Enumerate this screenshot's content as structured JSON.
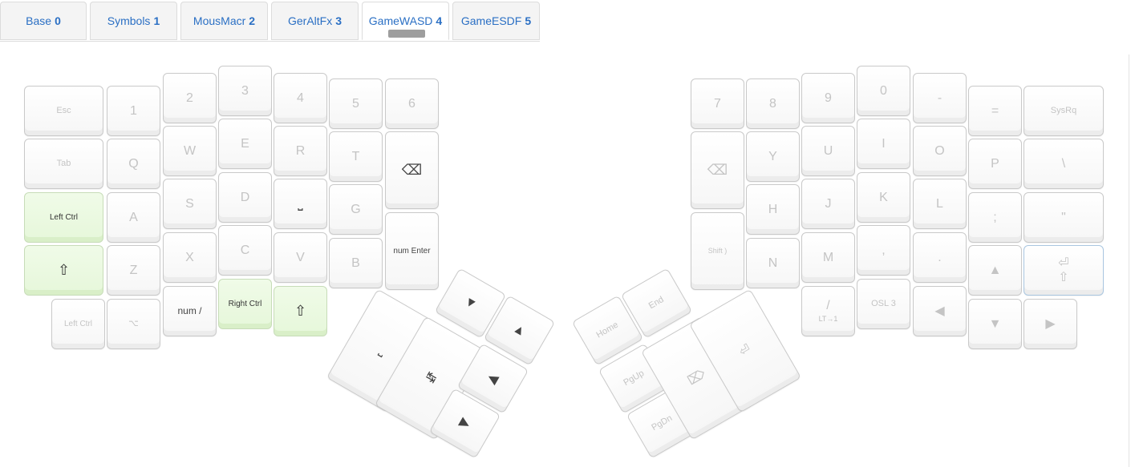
{
  "tabs": [
    {
      "label": "Base",
      "num": "0"
    },
    {
      "label": "Symbols",
      "num": "1"
    },
    {
      "label": "MousMacr",
      "num": "2"
    },
    {
      "label": "GerAltFx",
      "num": "3"
    },
    {
      "label": "GameWASD",
      "num": "4"
    },
    {
      "label": "GameESDF",
      "num": "5"
    }
  ],
  "active_tab": "GameWASD",
  "colors": {
    "accent": "#2a6fc4",
    "highlight_green": "#e6f7da",
    "selected_blue": "#a9c6e0"
  },
  "left": {
    "esc": "Esc",
    "k1": "1",
    "k2": "2",
    "k3": "3",
    "k4": "4",
    "k5": "5",
    "k6": "6",
    "tab": "Tab",
    "q": "Q",
    "w": "W",
    "e": "E",
    "r": "R",
    "t": "T",
    "bksp": "⌫",
    "lctrl": "Left Ctrl",
    "a": "A",
    "s": "S",
    "d": "D",
    "space": "⎵",
    "g": "G",
    "numenter": "num Enter",
    "shift": "⇧",
    "z": "Z",
    "x": "X",
    "c": "C",
    "v": "V",
    "b": "B",
    "lctrl2": "Left Ctrl",
    "alt": "⌥",
    "numslash": "num /",
    "rctrl": "Right Ctrl",
    "shift2": "⇧"
  },
  "left_thumb": {
    "space": "⎵",
    "tab": "↹",
    "down": "▼",
    "up": "▲",
    "left": "◀",
    "right": "▶"
  },
  "right": {
    "k7": "7",
    "k8": "8",
    "k9": "9",
    "k0": "0",
    "minus": "-",
    "equal": "=",
    "sysrq": "SysRq",
    "bksp": "⌫",
    "y": "Y",
    "u": "U",
    "i": "I",
    "o": "O",
    "p": "P",
    "backslash": "\\",
    "h": "H",
    "j": "J",
    "k": "K",
    "l": "L",
    "semicolon": ";",
    "quote": "\"",
    "shiftparen": "Shift )",
    "n": "N",
    "m": "M",
    "comma": ",",
    "period": ".",
    "up": "▲",
    "enter": "⏎",
    "enter_shift": "⇧",
    "slash": "/",
    "slash_sub": "LT→1",
    "osl": "OSL 3",
    "left": "◀",
    "down": "▼",
    "right": "▶"
  },
  "right_thumb": {
    "home": "Home",
    "end": "End",
    "pgup": "PgUp",
    "pgdn": "PgDn",
    "del": "⌦",
    "enter": "⏎"
  }
}
